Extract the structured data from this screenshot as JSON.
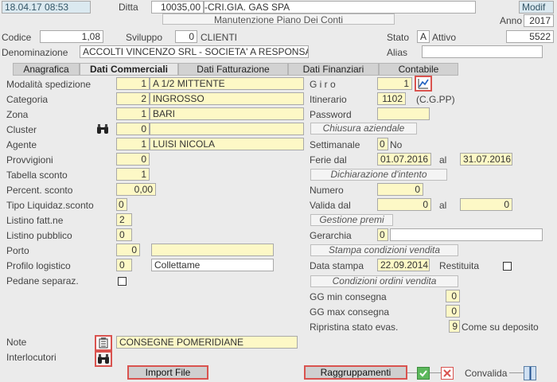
{
  "header": {
    "datetime": "18.04.17 08:53",
    "ditta_label": "Ditta",
    "ditta_code": "10035,00",
    "ditta_name": "CRI.GIA. GAS SPA",
    "mode": "Modif",
    "title": "Manutenzione Piano Dei Conti",
    "anno_label": "Anno",
    "anno": "2017"
  },
  "record": {
    "codice_label": "Codice",
    "codice": "1,08",
    "sviluppo_label": "Sviluppo",
    "sviluppo": "0",
    "sviluppo_desc": "CLIENTI",
    "stato_label": "Stato",
    "stato": "A",
    "stato_desc": "Attivo",
    "stato_num": "5522",
    "denominazione_label": "Denominazione",
    "denominazione": "ACCOLTI VINCENZO SRL - SOCIETA' A RESPONSABIL",
    "alias_label": "Alias",
    "alias": ""
  },
  "tabs": [
    "Anagrafica",
    "Dati Commerciali",
    "Dati Fatturazione",
    "Dati Finanziari",
    "Contabile"
  ],
  "left": {
    "modalita_label": "Modalità spedizione",
    "modalita_code": "1",
    "modalita_desc": "A 1/2 MITTENTE",
    "categoria_label": "Categoria",
    "categoria_code": "2",
    "categoria_desc": "INGROSSO",
    "zona_label": "Zona",
    "zona_code": "1",
    "zona_desc": "BARI",
    "cluster_label": "Cluster",
    "cluster_code": "0",
    "cluster_desc": "",
    "agente_label": "Agente",
    "agente_code": "1",
    "agente_desc": "LUISI NICOLA",
    "provvigioni_label": "Provvigioni",
    "provvigioni": "0",
    "tabella_label": "Tabella  sconto",
    "tabella": "1",
    "percent_label": "Percent. sconto",
    "percent": "0,00",
    "tipo_label": "Tipo Liquidaz.sconto",
    "tipo": "0",
    "listino_fatt_label": "Listino fatt.ne",
    "listino_fatt": "2",
    "listino_pub_label": "Listino pubblico",
    "listino_pub": "0",
    "porto_label": "Porto",
    "porto_code": "0",
    "porto_desc": "",
    "profilo_label": "Profilo logistico",
    "profilo_code": "0",
    "profilo_desc": "Collettame",
    "pedane_label": "Pedane separaz.",
    "note_label": "Note",
    "note": "CONSEGNE POMERIDIANE",
    "interlocutori_label": "Interlocutori"
  },
  "right": {
    "giro_label": "G i r o",
    "giro": "1",
    "itinerario_label": "Itinerario",
    "itinerario": "1102",
    "itinerario_desc": "(C.G.PP)",
    "password_label": "Password",
    "password": "",
    "chiusura_title": "Chiusura aziendale",
    "settimanale_label": "Settimanale",
    "settimanale": "0",
    "settimanale_desc": "No",
    "ferie_label": "Ferie dal",
    "ferie_dal": "01.07.2016",
    "al_label": "al",
    "ferie_al": "31.07.2016",
    "intento_title": "Dichiarazione d'intento",
    "numero_label": "Numero",
    "numero": "0",
    "valida_label": "Valida dal",
    "valida_dal": "0",
    "valida_al": "0",
    "premi_title": "Gestione premi",
    "gerarchia_label": "Gerarchia",
    "gerarchia": "0",
    "stampa_title": "Stampa condizioni vendita",
    "data_stampa_label": "Data stampa",
    "data_stampa": "22.09.2014",
    "restituita_label": "Restituita",
    "ordini_title": "Condizioni ordini vendita",
    "gg_min_label": "GG min consegna",
    "gg_min": "0",
    "gg_max_label": "GG max consegna",
    "gg_max": "0",
    "ripristina_label": "Ripristina stato evas.",
    "ripristina": "9",
    "ripristina_desc": "Come su deposito"
  },
  "footer": {
    "import_label": "Import File",
    "raggruppamenti_label": "Raggruppamenti",
    "convalida_label": "Convalida"
  },
  "colors": {
    "accent_red": "#d9534f",
    "field_yellow": "#fdf8c6",
    "confirm_green": "#5cb85c"
  }
}
